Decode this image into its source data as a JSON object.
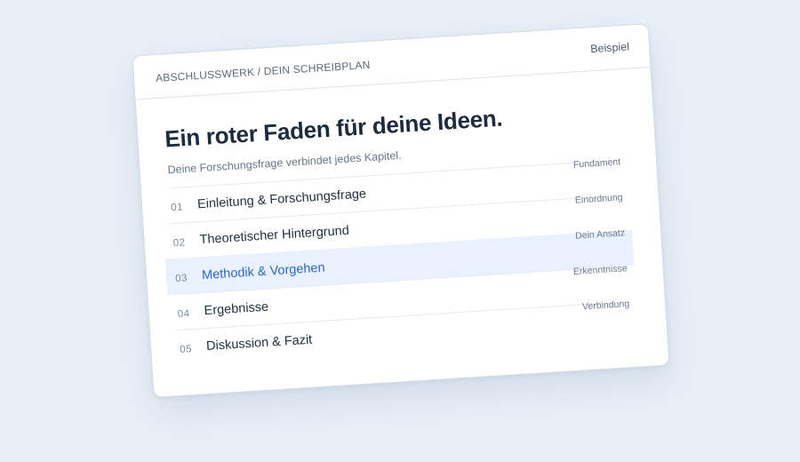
{
  "header": {
    "breadcrumb": "ABSCHLUSSWERK / DEIN SCHREIBPLAN",
    "example_link": "Beispiel"
  },
  "main": {
    "title": "Ein roter Faden für deine Ideen.",
    "subtitle": "Deine Forschungsfrage verbindet jedes Kapitel."
  },
  "chapters": [
    {
      "number": "01",
      "title": "Einleitung & Forschungsfrage",
      "tag": "Fundament",
      "active": false
    },
    {
      "number": "02",
      "title": "Theoretischer Hintergrund",
      "tag": "Einordnung",
      "active": false
    },
    {
      "number": "03",
      "title": "Methodik & Vorgehen",
      "tag": "Dein Ansatz",
      "active": true
    },
    {
      "number": "04",
      "title": "Ergebnisse",
      "tag": "Erkenntnisse",
      "active": false
    },
    {
      "number": "05",
      "title": "Diskussion & Fazit",
      "tag": "Verbindung",
      "active": false
    }
  ],
  "colors": {
    "background": "#e8eff7",
    "accent": "#2a67c6",
    "active_row": "#e9f1fd",
    "title": "#1c2b3d"
  }
}
